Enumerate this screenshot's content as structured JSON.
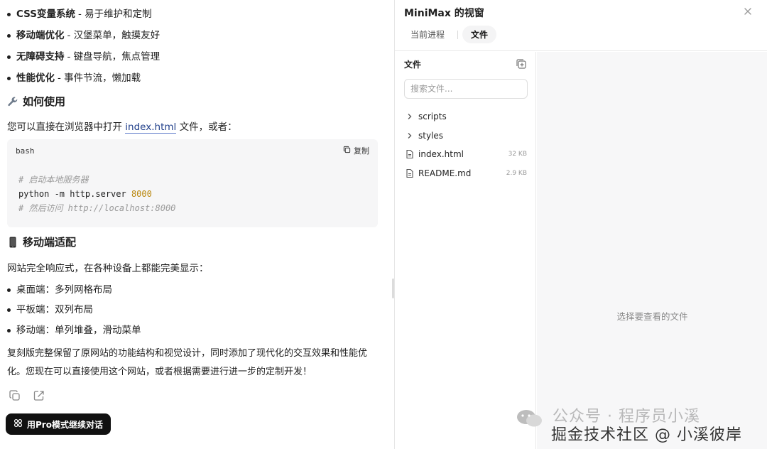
{
  "chat": {
    "features": [
      {
        "title": "CSS变量系统",
        "desc": "- 易于维护和定制"
      },
      {
        "title": "移动端优化",
        "desc": "- 汉堡菜单，触摸友好"
      },
      {
        "title": "无障碍支持",
        "desc": "- 键盘导航，焦点管理"
      },
      {
        "title": "性能优化",
        "desc": "- 事件节流，懒加载"
      }
    ],
    "howto_heading": "如何使用",
    "howto_text_before": "您可以直接在浏览器中打开",
    "howto_link": "index.html",
    "howto_text_after": "文件，或者：",
    "code": {
      "lang": "bash",
      "copy_label": "复制",
      "comment1": "# 启动本地服务器",
      "command": "python -m http.server",
      "port": "8000",
      "comment2": "# 然后访问 http://localhost:8000"
    },
    "mobile_heading": "移动端适配",
    "mobile_intro": "网站完全响应式，在各种设备上都能完美显示：",
    "devices": [
      "桌面端：多列网格布局",
      "平板端：双列布局",
      "移动端：单列堆叠，滑动菜单"
    ],
    "summary": "复刻版完整保留了原网站的功能结构和视觉设计，同时添加了现代化的交互效果和性能优化。您现在可以直接使用这个网站，或者根据需要进行进一步的定制开发！",
    "pro_button": "用Pro模式继续对话"
  },
  "panel": {
    "title": "MiniMax 的视窗",
    "tabs": [
      "当前进程",
      "文件"
    ],
    "active_tab": "文件",
    "files_title": "文件",
    "search_placeholder": "搜索文件...",
    "items": [
      {
        "type": "folder",
        "name": "scripts",
        "size": ""
      },
      {
        "type": "folder",
        "name": "styles",
        "size": ""
      },
      {
        "type": "file",
        "name": "index.html",
        "size": "32 KB"
      },
      {
        "type": "file",
        "name": "README.md",
        "size": "2.9 KB"
      }
    ],
    "empty_text": "选择要查看的文件"
  },
  "watermark": {
    "line1": "公众号 · 程序员小溪",
    "line2": "掘金技术社区 @ 小溪彼岸"
  }
}
